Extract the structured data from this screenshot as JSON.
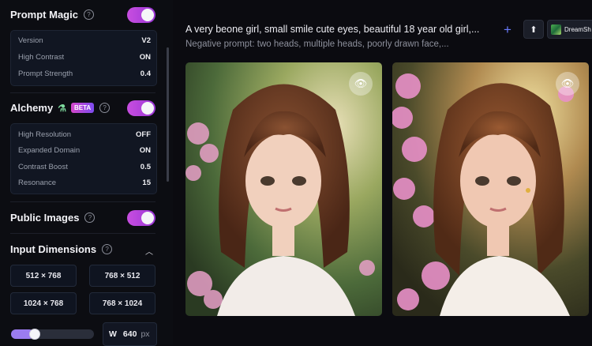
{
  "sidebar": {
    "prompt_magic": {
      "title": "Prompt Magic",
      "enabled": true,
      "rows": [
        {
          "label": "Version",
          "value": "V2"
        },
        {
          "label": "High Contrast",
          "value": "ON"
        },
        {
          "label": "Prompt Strength",
          "value": "0.4"
        }
      ]
    },
    "alchemy": {
      "title": "Alchemy",
      "badge": "BETA",
      "enabled": true,
      "rows": [
        {
          "label": "High Resolution",
          "value": "OFF"
        },
        {
          "label": "Expanded Domain",
          "value": "ON"
        },
        {
          "label": "Contrast Boost",
          "value": "0.5"
        },
        {
          "label": "Resonance",
          "value": "15"
        }
      ]
    },
    "public_images": {
      "title": "Public Images",
      "enabled": true
    },
    "input_dimensions": {
      "title": "Input Dimensions",
      "options": [
        "512 × 768",
        "768 × 512",
        "1024 × 768",
        "768 × 1024"
      ],
      "width_label": "W",
      "width_value": "640",
      "width_unit": "px",
      "slider_fraction": 0.25
    }
  },
  "main": {
    "prompt": "A very beone girl, small smile cute eyes, beautiful 18 year old girl,...",
    "negative_prompt": "Negative prompt: two heads, multiple heads, poorly drawn face,...",
    "model_label": "DreamSh"
  },
  "icons": {
    "help": "help-circle-icon",
    "plus": "plus-icon",
    "upload": "arrow-up-icon",
    "eye": "eye-icon",
    "flask": "flask-icon",
    "chevron": "chevron-up-icon"
  },
  "colors": {
    "accent_toggle": "#b544e0",
    "beta_badge_start": "#d547c9",
    "beta_badge_end": "#7d4cf0",
    "plus_icon": "#6a7cff"
  }
}
